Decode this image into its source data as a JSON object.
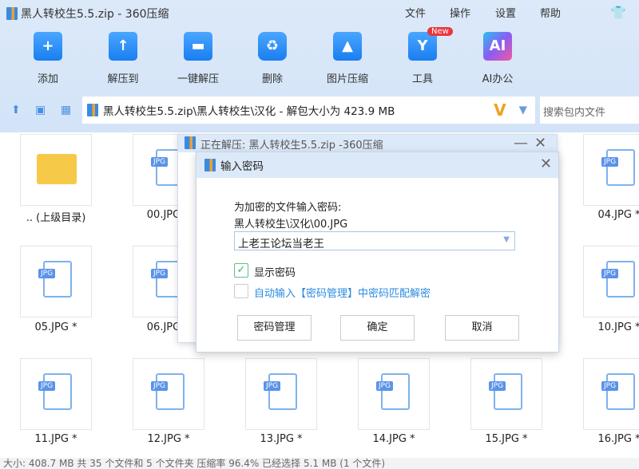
{
  "window": {
    "title": "黑人转校生5.5.zip - 360压缩"
  },
  "menu": [
    "文件",
    "操作",
    "设置",
    "帮助"
  ],
  "toolbar": [
    {
      "label": "添加",
      "icon": "+"
    },
    {
      "label": "解压到",
      "icon": "↑"
    },
    {
      "label": "一键解压",
      "icon": "▬"
    },
    {
      "label": "删除",
      "icon": "♻"
    },
    {
      "label": "图片压缩",
      "icon": "▲"
    },
    {
      "label": "工具",
      "icon": "Y",
      "badge": "New"
    },
    {
      "label": "AI办公",
      "icon": "AI"
    }
  ],
  "address": {
    "path": "黑人转校生5.5.zip\\黑人转校生\\汉化 - 解包大小为 423.9 MB",
    "search_placeholder": "搜索包内文件"
  },
  "files": {
    "up": ".. (上级目录)",
    "row1": [
      "00.JPG",
      "04.JPG *"
    ],
    "row2": [
      "05.JPG *",
      "06.JPG",
      "10.JPG *"
    ],
    "row3": [
      "11.JPG *",
      "12.JPG *",
      "13.JPG *",
      "14.JPG *",
      "15.JPG *",
      "16.JPG *"
    ],
    "tag": "JPG"
  },
  "status": "大小: 408.7 MB 共 35 个文件和 5 个文件夹 压缩率 96.4% 已经选择 5.1 MB (1 个文件)",
  "progress_window": {
    "title": "正在解压: 黑人转校生5.5.zip -360压缩"
  },
  "dialog": {
    "title": "输入密码",
    "prompt": "为加密的文件输入密码:",
    "file": "黑人转校生\\汉化\\00.JPG",
    "password": "上老王论坛当老王",
    "show_password": "显示密码",
    "auto_fill": "自动输入【密码管理】中密码匹配解密",
    "btn_manage": "密码管理",
    "btn_ok": "确定",
    "btn_cancel": "取消"
  }
}
